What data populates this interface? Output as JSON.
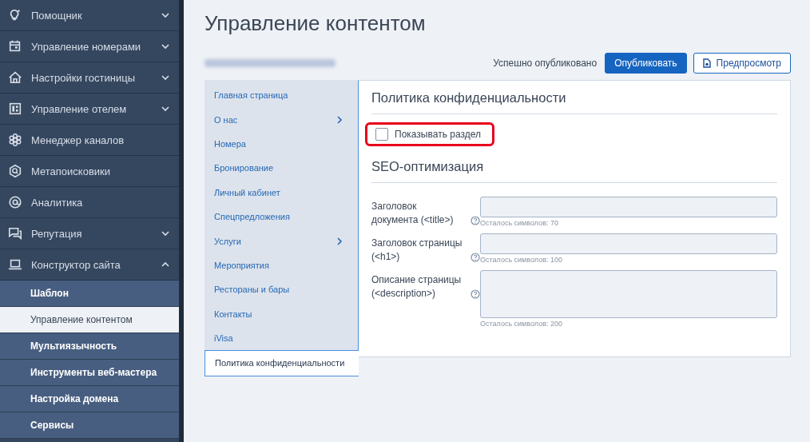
{
  "sidebar": {
    "items": [
      {
        "label": "Помощник",
        "expanded": false
      },
      {
        "label": "Управление номерами",
        "expanded": false
      },
      {
        "label": "Настройки гостиницы",
        "expanded": false
      },
      {
        "label": "Управление отелем",
        "expanded": false
      },
      {
        "label": "Менеджер каналов"
      },
      {
        "label": "Метапоисковики"
      },
      {
        "label": "Аналитика"
      },
      {
        "label": "Репутация",
        "expanded": false
      },
      {
        "label": "Конструктор сайта",
        "expanded": true,
        "children": [
          {
            "label": "Шаблон",
            "selected": false
          },
          {
            "label": "Управление контентом",
            "selected": true
          },
          {
            "label": "Мультиязычность",
            "selected": false
          },
          {
            "label": "Инструменты веб-мастера",
            "selected": false
          },
          {
            "label": "Настройка домена",
            "selected": false
          },
          {
            "label": "Сервисы",
            "selected": false
          }
        ]
      }
    ]
  },
  "page": {
    "title": "Управление контентом",
    "status": "Успешно опубликовано",
    "buttons": [
      {
        "label": "Опубликовать",
        "kind": "primary"
      },
      {
        "label": "Предпросмотр",
        "kind": "preview"
      }
    ]
  },
  "content_nav": [
    {
      "label": "Главная страница",
      "has_children": false,
      "selected": false
    },
    {
      "label": "О нас",
      "has_children": true,
      "selected": false
    },
    {
      "label": "Номера",
      "has_children": false,
      "selected": false
    },
    {
      "label": "Бронирование",
      "has_children": false,
      "selected": false
    },
    {
      "label": "Личный кабинет",
      "has_children": false,
      "selected": false
    },
    {
      "label": "Спецпредложения",
      "has_children": false,
      "selected": false
    },
    {
      "label": "Услуги",
      "has_children": true,
      "selected": false
    },
    {
      "label": "Мероприятия",
      "has_children": false,
      "selected": false
    },
    {
      "label": "Рестораны и бары",
      "has_children": false,
      "selected": false
    },
    {
      "label": "Контакты",
      "has_children": false,
      "selected": false
    },
    {
      "label": "iVisa",
      "has_children": false,
      "selected": false
    },
    {
      "label": "Политика конфиденциальности",
      "has_children": false,
      "selected": true
    }
  ],
  "panel": {
    "title": "Политика конфиденциальности",
    "show_section": {
      "label": "Показывать раздел",
      "checked": false,
      "highlighted": true
    },
    "seo_title": "SEO-оптимизация",
    "fields": [
      {
        "label": "Заголовок документа (<title>)",
        "kind": "input",
        "hint": "Осталось символов: 70"
      },
      {
        "label": "Заголовок страницы (<h1>)",
        "kind": "input",
        "hint": "Осталось символов: 100"
      },
      {
        "label": "Описание страницы (<description>)",
        "kind": "textarea",
        "hint": "Осталось символов: 200"
      }
    ]
  }
}
